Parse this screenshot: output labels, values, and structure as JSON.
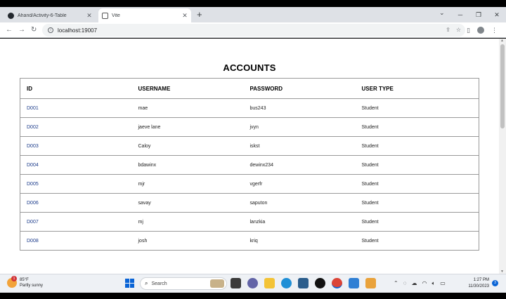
{
  "browser": {
    "tabs": [
      {
        "title": "Ahand/Activity-6-Table",
        "active": false
      },
      {
        "title": "Vite",
        "active": true
      }
    ],
    "url": "localhost:19007"
  },
  "page": {
    "title": "ACCOUNTS",
    "columns": [
      "ID",
      "USERNAME",
      "PASSWORD",
      "USER TYPE"
    ],
    "rows": [
      {
        "id": "D001",
        "username": "mae",
        "password": "bus243",
        "user_type": "Student"
      },
      {
        "id": "D002",
        "username": "jaeve lane",
        "password": "jvyn",
        "user_type": "Student"
      },
      {
        "id": "D003",
        "username": "Caloy",
        "password": "iskst",
        "user_type": "Student"
      },
      {
        "id": "D004",
        "username": "bdawinx",
        "password": "dewinx234",
        "user_type": "Student"
      },
      {
        "id": "D005",
        "username": "mjr",
        "password": "vgerfr",
        "user_type": "Student"
      },
      {
        "id": "D006",
        "username": "savay",
        "password": "saputon",
        "user_type": "Student"
      },
      {
        "id": "D007",
        "username": "mj",
        "password": "lanzkia",
        "user_type": "Student"
      },
      {
        "id": "D008",
        "username": "josh",
        "password": "kriq",
        "user_type": "Student"
      }
    ]
  },
  "taskbar": {
    "weather_temp": "85°F",
    "weather_desc": "Partly sunny",
    "weather_badge": "1",
    "search_placeholder": "Search",
    "time": "1:27 PM",
    "date": "11/30/2023",
    "notification_count": "3"
  },
  "colors": {
    "accent": "#0a64d6",
    "id_text": "#1a3a8a"
  }
}
